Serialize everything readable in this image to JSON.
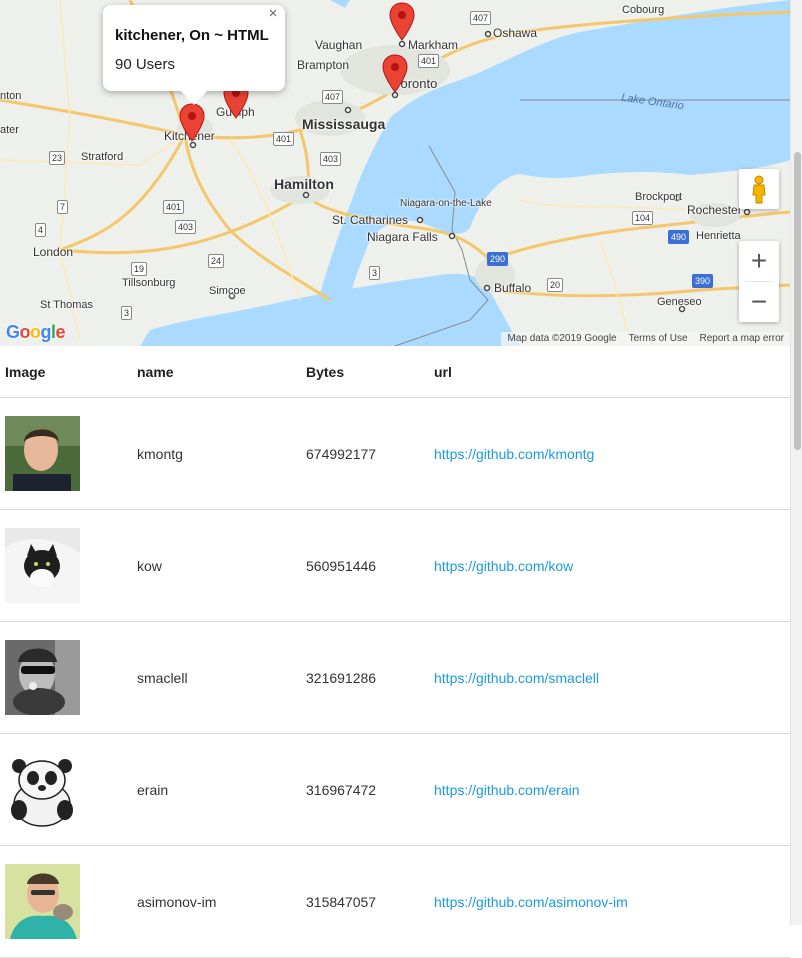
{
  "map": {
    "labels": {
      "markham": "Markham",
      "oshawa": "Oshawa",
      "cobourg": "Cobourg",
      "vaughan": "Vaughan",
      "brampton": "Brampton",
      "toronto": "Toronto",
      "guelph": "Guelph",
      "mississauga": "Mississauga",
      "kitchener": "Kitchener",
      "stratford": "Stratford",
      "hamilton": "Hamilton",
      "niagara_otl": "Niagara-on-the-Lake",
      "st_catharines": "St. Catharines",
      "niagara_falls": "Niagara Falls",
      "brockport": "Brockport",
      "rochester": "Rochester",
      "henrietta": "Henrietta",
      "london": "London",
      "tillsonburg": "Tillsonburg",
      "simcoe": "Simcoe",
      "buffalo": "Buffalo",
      "geneseo": "Geneseo",
      "st_thomas": "St Thomas",
      "lake_ontario": "Lake Ontario",
      "left_edge_1": "nton",
      "left_edge_2": "ater"
    },
    "shields": {
      "s407a": "407",
      "s401a": "401",
      "s407b": "407",
      "s401b": "401",
      "s403a": "403",
      "s23": "23",
      "s7": "7",
      "s4": "4",
      "s401c": "401",
      "s403b": "403",
      "s24": "24",
      "s19": "19",
      "s3a": "3",
      "s3b": "3",
      "s290": "290",
      "s20": "20",
      "s490": "490",
      "s390": "390",
      "s104": "104"
    },
    "infowindow": {
      "title": "kitchener, On ~ HTML",
      "body": "90 Users",
      "close": "×"
    },
    "controls": {
      "zoom_in": "+",
      "zoom_out": "−"
    },
    "attribution": {
      "data": "Map data ©2019 Google",
      "terms": "Terms of Use",
      "report": "Report a map error"
    },
    "logo": "Google",
    "colors": {
      "water": "#aadaff",
      "marker": "#ea4335",
      "highway": "#f5c76b"
    }
  },
  "table": {
    "headers": {
      "image": "Image",
      "name": "name",
      "bytes": "Bytes",
      "url": "url"
    },
    "rows": [
      {
        "name": "kmontg",
        "bytes": "674992177",
        "url": "https://github.com/kmontg"
      },
      {
        "name": "kow",
        "bytes": "560951446",
        "url": "https://github.com/kow"
      },
      {
        "name": "smaclell",
        "bytes": "321691286",
        "url": "https://github.com/smaclell"
      },
      {
        "name": "erain",
        "bytes": "316967472",
        "url": "https://github.com/erain"
      },
      {
        "name": "asimonov-im",
        "bytes": "315847057",
        "url": "https://github.com/asimonov-im"
      }
    ]
  }
}
